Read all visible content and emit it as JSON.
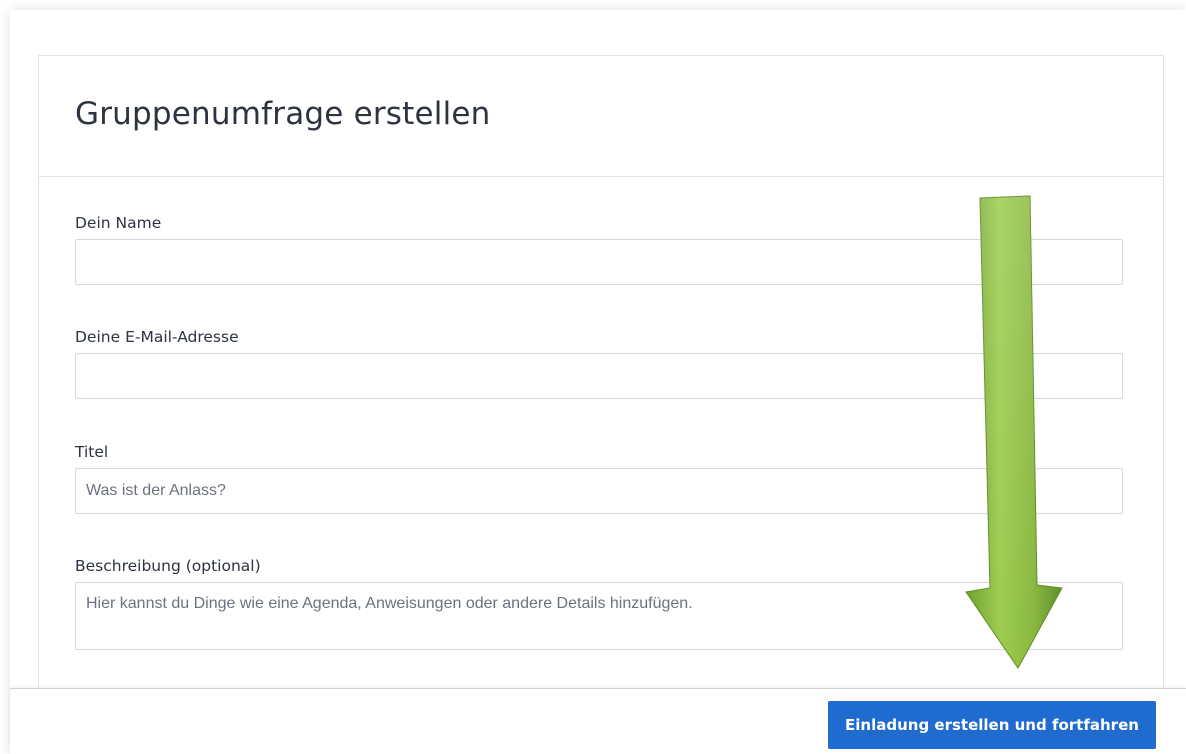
{
  "form": {
    "title": "Gruppenumfrage erstellen",
    "fields": {
      "name": {
        "label": "Dein Name",
        "value": "",
        "placeholder": ""
      },
      "email": {
        "label": "Deine E-Mail-Adresse",
        "value": "",
        "placeholder": ""
      },
      "title": {
        "label": "Titel",
        "value": "",
        "placeholder": "Was ist der Anlass?"
      },
      "description": {
        "label": "Beschreibung (optional)",
        "value": "",
        "placeholder": "Hier kannst du Dinge wie eine Agenda, Anweisungen oder andere Details hinzufügen."
      }
    }
  },
  "footer": {
    "submit_label": "Einladung erstellen und fortfahren"
  },
  "colors": {
    "primary_button": "#1f6bd0",
    "annotation_arrow": "#7fb23a"
  },
  "annotation": {
    "icon": "down-arrow-icon"
  }
}
